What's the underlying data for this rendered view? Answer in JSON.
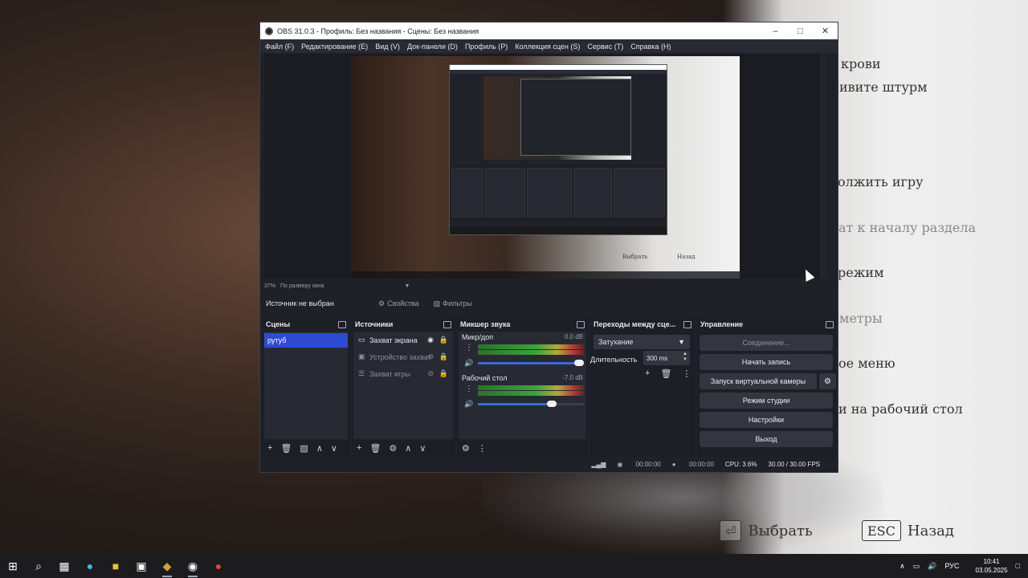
{
  "background": {
    "menu_items": [
      {
        "text": "крови",
        "faded": false
      },
      {
        "text": "ивите штурм",
        "faded": false
      },
      {
        "text": "олжить игру",
        "faded": false
      },
      {
        "text": "ат к началу раздела",
        "faded": true
      },
      {
        "text": "режим",
        "faded": false
      },
      {
        "text": "метры",
        "faded": true
      },
      {
        "text": "ое меню",
        "faded": false
      },
      {
        "text": "и на рабочий стол",
        "faded": false
      }
    ],
    "hint_select": {
      "key": "⏎",
      "label": "Выбрать"
    },
    "hint_back": {
      "key": "ESC",
      "label": "Назад"
    }
  },
  "obs": {
    "title": "OBS 31.0.3 - Профиль: Без названия - Сцены: Без названия",
    "menu": [
      "Файл (F)",
      "Редактирование (E)",
      "Вид (V)",
      "Док-панели (D)",
      "Профиль (P)",
      "Коллекция сцен (S)",
      "Сервис (T)",
      "Справка (H)"
    ],
    "zoom_percent": "37%",
    "zoom_mode": "По размеру окна",
    "no_source": "Источник не выбран",
    "properties_label": "Свойства",
    "filters_label": "Фильтры",
    "preview_hints": {
      "select": "Выбрать",
      "back": "Назад"
    },
    "scenes": {
      "title": "Сцены",
      "items": [
        "рутуб"
      ]
    },
    "sources": {
      "title": "Источники",
      "items": [
        {
          "label": "Захват экрана",
          "icon": "monitor-icon",
          "dim": false
        },
        {
          "label": "Устройство захвата",
          "icon": "camera-icon",
          "dim": true
        },
        {
          "label": "Захват игры",
          "icon": "gamepad-icon",
          "dim": true
        }
      ]
    },
    "mixer": {
      "title": "Микшер звука",
      "tracks": [
        {
          "name": "Микр/доп",
          "db": "0.0 dB",
          "volume_percent": 100
        },
        {
          "name": "Рабочий стол",
          "db": "-7.0 dB",
          "volume_percent": 70
        }
      ],
      "ticks": "-60 -55 -50 -45 -40 -35 -30 -25 -20 -15 -10 -5 0"
    },
    "transitions": {
      "title": "Переходы между сце...",
      "selected": "Затухание",
      "duration_label": "Длительность",
      "duration_value": "300 ms"
    },
    "controls": {
      "title": "Управление",
      "connecting": "Соединение...",
      "start_recording": "Начать запись",
      "virtual_camera": "Запуск виртуальной камеры",
      "studio_mode": "Режим студии",
      "settings": "Настройки",
      "exit": "Выход"
    },
    "status": {
      "stream_time": "00:00:00",
      "rec_time": "00:00:00",
      "cpu": "CPU: 3.6%",
      "fps": "30.00 / 30.00 FPS"
    }
  },
  "taskbar": {
    "lang": "РУС",
    "time": "10:41",
    "date": "03.05.2025"
  }
}
